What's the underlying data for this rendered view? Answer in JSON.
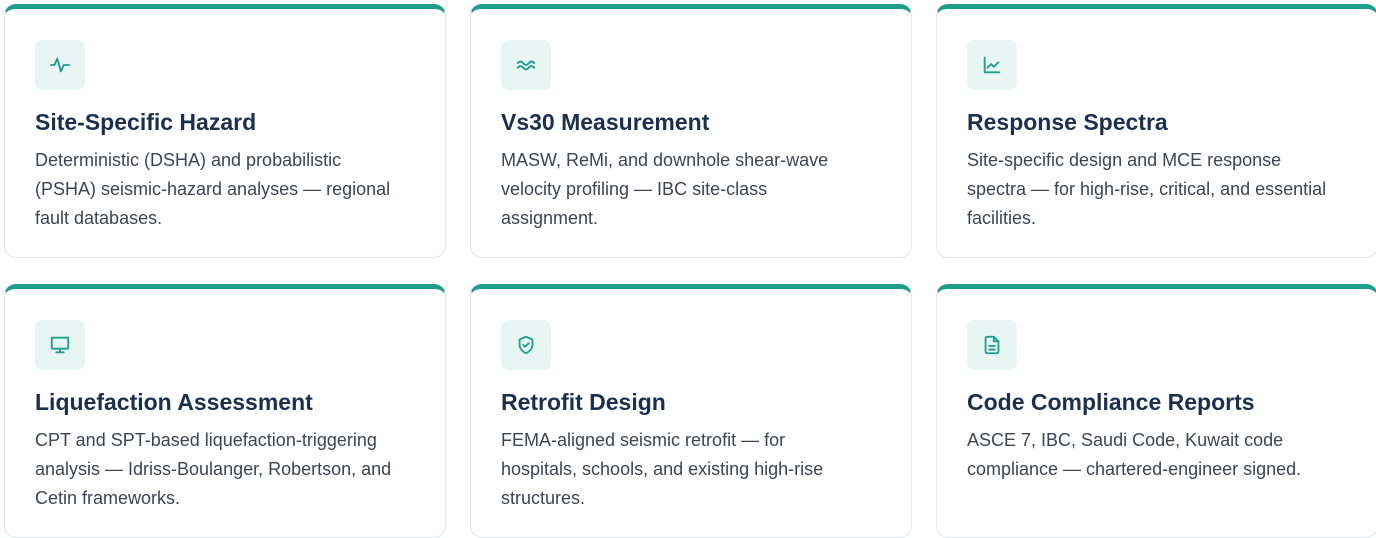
{
  "accent_color": "#1f9e8c",
  "cards": [
    {
      "icon": "activity-icon",
      "title": "Site-Specific Hazard",
      "description": "Deterministic (DSHA) and probabilistic (PSHA) seismic-hazard analyses — regional fault databases."
    },
    {
      "icon": "waves-icon",
      "title": "Vs30 Measurement",
      "description": "MASW, ReMi, and downhole shear-wave velocity profiling — IBC site-class assignment."
    },
    {
      "icon": "line-chart-icon",
      "title": "Response Spectra",
      "description": "Site-specific design and MCE response spectra — for high-rise, critical, and essential facilities."
    },
    {
      "icon": "monitor-icon",
      "title": "Liquefaction Assessment",
      "description": "CPT and SPT-based liquefaction-triggering analysis — Idriss-Boulanger, Robertson, and Cetin frameworks."
    },
    {
      "icon": "shield-check-icon",
      "title": "Retrofit Design",
      "description": "FEMA-aligned seismic retrofit — for hospitals, schools, and existing high-rise structures."
    },
    {
      "icon": "file-text-icon",
      "title": "Code Compliance Reports",
      "description": "ASCE 7, IBC, Saudi Code, Kuwait code compliance — chartered-engineer signed."
    }
  ]
}
